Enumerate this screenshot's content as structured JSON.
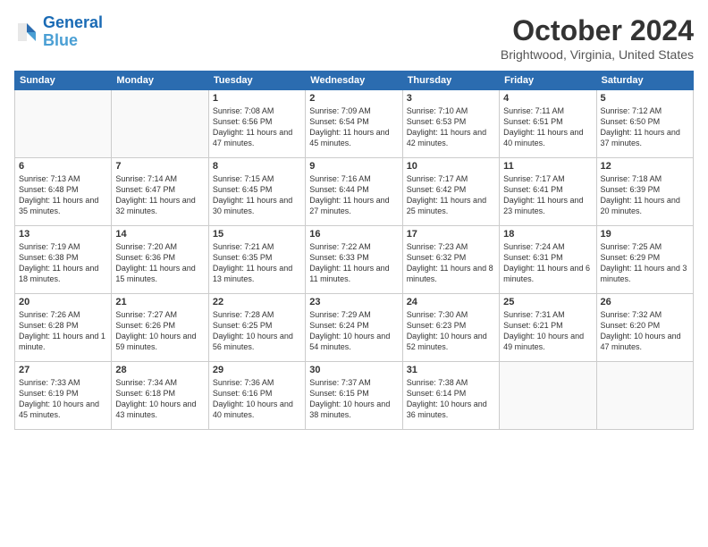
{
  "logo": {
    "line1": "General",
    "line2": "Blue"
  },
  "title": "October 2024",
  "subtitle": "Brightwood, Virginia, United States",
  "days_of_week": [
    "Sunday",
    "Monday",
    "Tuesday",
    "Wednesday",
    "Thursday",
    "Friday",
    "Saturday"
  ],
  "weeks": [
    [
      {
        "num": "",
        "info": ""
      },
      {
        "num": "",
        "info": ""
      },
      {
        "num": "1",
        "info": "Sunrise: 7:08 AM\nSunset: 6:56 PM\nDaylight: 11 hours and 47 minutes."
      },
      {
        "num": "2",
        "info": "Sunrise: 7:09 AM\nSunset: 6:54 PM\nDaylight: 11 hours and 45 minutes."
      },
      {
        "num": "3",
        "info": "Sunrise: 7:10 AM\nSunset: 6:53 PM\nDaylight: 11 hours and 42 minutes."
      },
      {
        "num": "4",
        "info": "Sunrise: 7:11 AM\nSunset: 6:51 PM\nDaylight: 11 hours and 40 minutes."
      },
      {
        "num": "5",
        "info": "Sunrise: 7:12 AM\nSunset: 6:50 PM\nDaylight: 11 hours and 37 minutes."
      }
    ],
    [
      {
        "num": "6",
        "info": "Sunrise: 7:13 AM\nSunset: 6:48 PM\nDaylight: 11 hours and 35 minutes."
      },
      {
        "num": "7",
        "info": "Sunrise: 7:14 AM\nSunset: 6:47 PM\nDaylight: 11 hours and 32 minutes."
      },
      {
        "num": "8",
        "info": "Sunrise: 7:15 AM\nSunset: 6:45 PM\nDaylight: 11 hours and 30 minutes."
      },
      {
        "num": "9",
        "info": "Sunrise: 7:16 AM\nSunset: 6:44 PM\nDaylight: 11 hours and 27 minutes."
      },
      {
        "num": "10",
        "info": "Sunrise: 7:17 AM\nSunset: 6:42 PM\nDaylight: 11 hours and 25 minutes."
      },
      {
        "num": "11",
        "info": "Sunrise: 7:17 AM\nSunset: 6:41 PM\nDaylight: 11 hours and 23 minutes."
      },
      {
        "num": "12",
        "info": "Sunrise: 7:18 AM\nSunset: 6:39 PM\nDaylight: 11 hours and 20 minutes."
      }
    ],
    [
      {
        "num": "13",
        "info": "Sunrise: 7:19 AM\nSunset: 6:38 PM\nDaylight: 11 hours and 18 minutes."
      },
      {
        "num": "14",
        "info": "Sunrise: 7:20 AM\nSunset: 6:36 PM\nDaylight: 11 hours and 15 minutes."
      },
      {
        "num": "15",
        "info": "Sunrise: 7:21 AM\nSunset: 6:35 PM\nDaylight: 11 hours and 13 minutes."
      },
      {
        "num": "16",
        "info": "Sunrise: 7:22 AM\nSunset: 6:33 PM\nDaylight: 11 hours and 11 minutes."
      },
      {
        "num": "17",
        "info": "Sunrise: 7:23 AM\nSunset: 6:32 PM\nDaylight: 11 hours and 8 minutes."
      },
      {
        "num": "18",
        "info": "Sunrise: 7:24 AM\nSunset: 6:31 PM\nDaylight: 11 hours and 6 minutes."
      },
      {
        "num": "19",
        "info": "Sunrise: 7:25 AM\nSunset: 6:29 PM\nDaylight: 11 hours and 3 minutes."
      }
    ],
    [
      {
        "num": "20",
        "info": "Sunrise: 7:26 AM\nSunset: 6:28 PM\nDaylight: 11 hours and 1 minute."
      },
      {
        "num": "21",
        "info": "Sunrise: 7:27 AM\nSunset: 6:26 PM\nDaylight: 10 hours and 59 minutes."
      },
      {
        "num": "22",
        "info": "Sunrise: 7:28 AM\nSunset: 6:25 PM\nDaylight: 10 hours and 56 minutes."
      },
      {
        "num": "23",
        "info": "Sunrise: 7:29 AM\nSunset: 6:24 PM\nDaylight: 10 hours and 54 minutes."
      },
      {
        "num": "24",
        "info": "Sunrise: 7:30 AM\nSunset: 6:23 PM\nDaylight: 10 hours and 52 minutes."
      },
      {
        "num": "25",
        "info": "Sunrise: 7:31 AM\nSunset: 6:21 PM\nDaylight: 10 hours and 49 minutes."
      },
      {
        "num": "26",
        "info": "Sunrise: 7:32 AM\nSunset: 6:20 PM\nDaylight: 10 hours and 47 minutes."
      }
    ],
    [
      {
        "num": "27",
        "info": "Sunrise: 7:33 AM\nSunset: 6:19 PM\nDaylight: 10 hours and 45 minutes."
      },
      {
        "num": "28",
        "info": "Sunrise: 7:34 AM\nSunset: 6:18 PM\nDaylight: 10 hours and 43 minutes."
      },
      {
        "num": "29",
        "info": "Sunrise: 7:36 AM\nSunset: 6:16 PM\nDaylight: 10 hours and 40 minutes."
      },
      {
        "num": "30",
        "info": "Sunrise: 7:37 AM\nSunset: 6:15 PM\nDaylight: 10 hours and 38 minutes."
      },
      {
        "num": "31",
        "info": "Sunrise: 7:38 AM\nSunset: 6:14 PM\nDaylight: 10 hours and 36 minutes."
      },
      {
        "num": "",
        "info": ""
      },
      {
        "num": "",
        "info": ""
      }
    ]
  ]
}
